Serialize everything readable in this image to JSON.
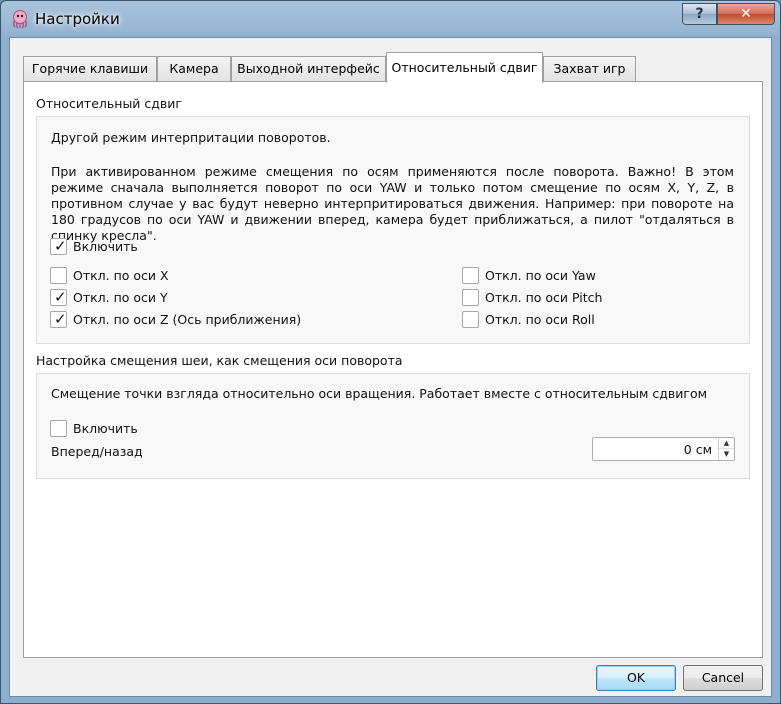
{
  "window": {
    "title": "Настройки",
    "help_label": "?",
    "close_label": "✕"
  },
  "tabs": [
    {
      "label": "Горячие клавиши"
    },
    {
      "label": "Камера"
    },
    {
      "label": "Выходной интерфейс"
    },
    {
      "label": "Относительный сдвиг",
      "active": true
    },
    {
      "label": "Захват игр"
    }
  ],
  "relative_shift": {
    "title": "Относительный сдвиг",
    "description": "Другой режим интерпритации поворотов.",
    "details": "При активированном режиме смещения по осям применяются после поворота. Важно! В этом режиме сначала выполняется поворот по оси YAW и только потом смещение по осям X, Y, Z, в противном случае у вас будут неверно интерпритироваться движения. Например: при повороте на 180 градусов по оси YAW и движении вперед, камера будет приближаться, а пилот \"отдаляться в спинку кресла\".",
    "enable": {
      "label": "Включить",
      "checked": true
    },
    "axes_left": [
      {
        "label": "Откл. по оси X",
        "checked": false
      },
      {
        "label": "Откл. по оси Y",
        "checked": true
      },
      {
        "label": "Откл. по оси Z (Ось приближения)",
        "checked": true
      }
    ],
    "axes_right": [
      {
        "label": "Откл. по оси Yaw",
        "checked": false
      },
      {
        "label": "Откл. по оси Pitch",
        "checked": false
      },
      {
        "label": "Откл. по оси Roll",
        "checked": false
      }
    ]
  },
  "neck_shift": {
    "title": "Настройка смещения шеи, как смещения оси поворота",
    "description": "Смещение точки взгляда относительно оси вращения. Работает вместе с относительным сдвигом",
    "enable": {
      "label": "Включить",
      "checked": false
    },
    "forward_back_label": "Вперед/назад",
    "forward_back_value": "0 см"
  },
  "buttons": {
    "ok": "OK",
    "cancel": "Cancel"
  },
  "check_glyph": "✓"
}
